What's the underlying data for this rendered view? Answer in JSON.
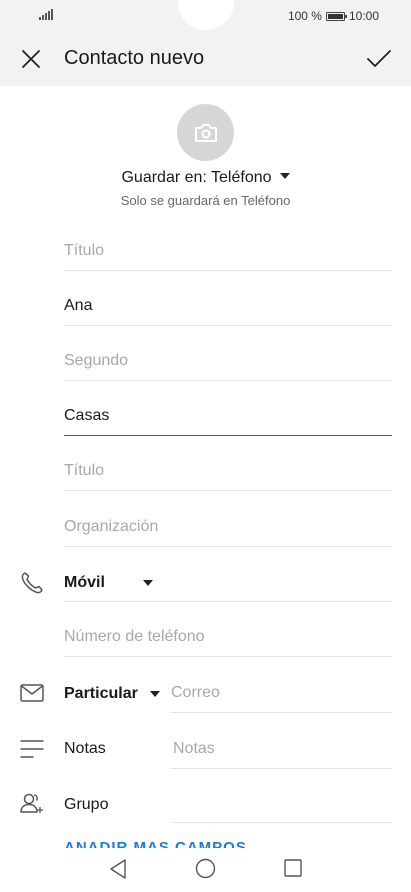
{
  "status_bar": {
    "battery_percent": "100 %",
    "time": "10:00"
  },
  "header": {
    "title": "Contacto nuevo"
  },
  "save_location": {
    "label": "Guardar en: Teléfono",
    "note": "Solo se guardará en Teléfono"
  },
  "fields": {
    "prefix_placeholder": "Título",
    "first_name_value": "Ana",
    "middle_name_placeholder": "Segundo",
    "last_name_value": "Casas",
    "job_title_placeholder": "Título",
    "organization_placeholder": "Organización"
  },
  "phone": {
    "type_label": "Móvil",
    "number_placeholder": "Número de teléfono"
  },
  "email": {
    "type_label": "Particular",
    "placeholder": "Correo"
  },
  "notes": {
    "label": "Notas",
    "placeholder": "Notas"
  },
  "group": {
    "label": "Grupo"
  },
  "add_more": {
    "label": "AÑADIR MÁS CAMPOS"
  },
  "colors": {
    "header_bg": "#f2f2f2",
    "accent": "#1e7ad8",
    "avatar_bg": "#d6d6d6"
  }
}
